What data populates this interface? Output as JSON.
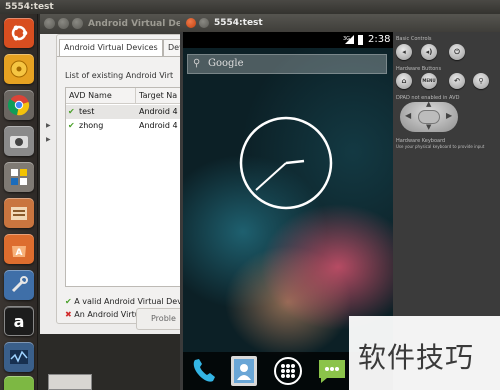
{
  "topbar": {
    "title": "5554:test"
  },
  "avd_window": {
    "title": "Android Virtual Device Manager",
    "tabs": [
      "Android Virtual Devices",
      "Dev"
    ],
    "subtitle": "List of existing Android Virt",
    "columns": [
      "AVD Name",
      "Target Na"
    ],
    "rows": [
      {
        "name": "test",
        "target": "Android 4",
        "valid": true
      },
      {
        "name": "zhong",
        "target": "Android 4",
        "valid": true
      }
    ],
    "legend_valid": "A valid Android Virtual Dev",
    "legend_invalid": "An Android Virtual Devic",
    "problems_tab": "Proble"
  },
  "emulator": {
    "title": "5554:test",
    "status_time": "2:38",
    "search_placeholder": "Google",
    "controls": {
      "basic": "Basic Controls",
      "hardware": "Hardware Buttons",
      "menu": "MENU",
      "dpad": "DPAD not enabled in AVD",
      "keyboard_title": "Hardware Keyboard",
      "keyboard_hint": "Use your physical keyboard to provide input"
    }
  },
  "watermark": {
    "text": "软件技巧"
  },
  "colors": {
    "accent_green": "#4aa029",
    "accent_red": "#d12b2b",
    "ubuntu_orange": "#e95420"
  }
}
